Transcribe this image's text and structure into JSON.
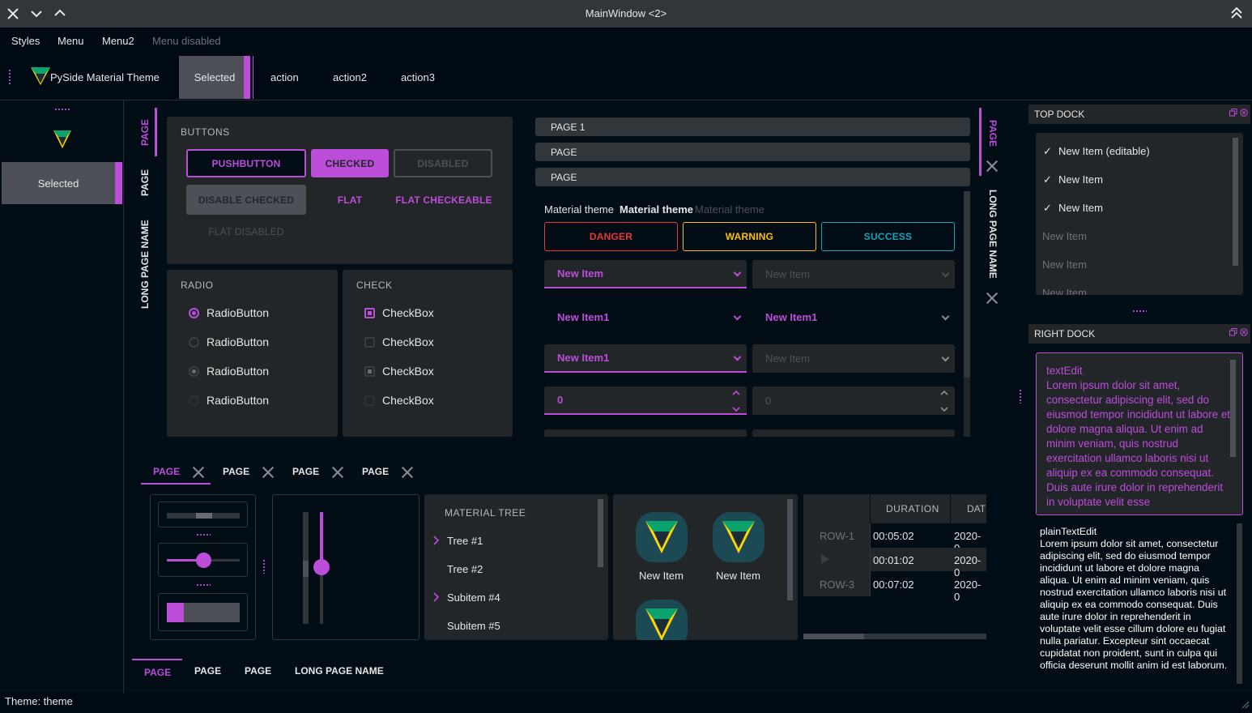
{
  "window": {
    "title": "MainWindow <2>"
  },
  "menubar": {
    "items": [
      "Styles",
      "Menu",
      "Menu2"
    ],
    "disabled_item": "Menu disabled"
  },
  "toolbar": {
    "app_name": "PySide Material Theme",
    "selected": "Selected",
    "actions": [
      "action",
      "action2",
      "action3"
    ]
  },
  "leftbar": {
    "selected": "Selected"
  },
  "vtabs_left": [
    "PAGE",
    "PAGE",
    "LONG PAGE NAME"
  ],
  "buttons": {
    "title": "BUTTONS",
    "pushbutton": "PUSHBUTTON",
    "checked": "CHECKED",
    "disabled": "DISABLED",
    "disable_checked": "DISABLE CHECKED",
    "flat": "FLAT",
    "flat_checkeable": "FLAT CHECKEABLE",
    "flat_disabled": "FLAT DISABLED"
  },
  "radio": {
    "title": "RADIO",
    "items": [
      "RadioButton",
      "RadioButton",
      "RadioButton",
      "RadioButton"
    ]
  },
  "check": {
    "title": "CHECK",
    "items": [
      "CheckBox",
      "CheckBox",
      "CheckBox",
      "CheckBox"
    ]
  },
  "toolbox": {
    "pages": [
      "PAGE 1",
      "PAGE",
      "PAGE"
    ]
  },
  "labels": {
    "normal": "Material theme",
    "bold": "Material theme",
    "disabled": "Material theme"
  },
  "status_buttons": {
    "danger": "DANGER",
    "warning": "WARNING",
    "success": "SUCCESS"
  },
  "combos": {
    "c1": "New Item",
    "c2": "New Item",
    "c3": "New Item1",
    "c4": "New Item1",
    "c5": "New Item1",
    "c6": "New Item",
    "spin1": "0",
    "spin2": "0"
  },
  "vtabs_right": [
    "PAGE",
    "LONG PAGE NAME"
  ],
  "htabs": [
    "PAGE",
    "PAGE",
    "PAGE",
    "PAGE"
  ],
  "tree": {
    "header": "MATERIAL TREE",
    "items": [
      "Tree #1",
      "Tree #2",
      "Subitem #4",
      "Subitem #5"
    ]
  },
  "iconlist": {
    "items": [
      "New Item",
      "New Item"
    ]
  },
  "table": {
    "headers": [
      "DURATION",
      "DAT"
    ],
    "rows": [
      {
        "label": "ROW-1",
        "duration": "00:05:02",
        "date": "2020-0"
      },
      {
        "label": "",
        "duration": "00:01:02",
        "date": "2020-0"
      },
      {
        "label": "ROW-3",
        "duration": "00:07:02",
        "date": "2020-0"
      }
    ]
  },
  "bottom_tabs": [
    "PAGE",
    "PAGE",
    "PAGE",
    "LONG PAGE NAME"
  ],
  "top_dock": {
    "title": "TOP DOCK",
    "items": [
      {
        "label": "New Item (editable)",
        "checked": true
      },
      {
        "label": "New Item",
        "checked": true
      },
      {
        "label": "New Item",
        "checked": true
      },
      {
        "label": "New Item",
        "checked": false
      },
      {
        "label": "New Item",
        "checked": false
      },
      {
        "label": "New Item",
        "checked": false
      }
    ],
    "checkmark": "✓"
  },
  "right_dock": {
    "title": "RIGHT DOCK",
    "textedit": "textEdit\nLorem ipsum dolor sit amet, consectetur adipiscing elit, sed do eiusmod tempor incididunt ut labore et dolore magna aliqua. Ut enim ad minim veniam, quis nostrud exercitation ullamco laboris nisi ut aliquip ex ea commodo consequat. Duis aute irure dolor in reprehenderit in voluptate velit esse",
    "plaintext": "plainTextEdit\nLorem ipsum dolor sit amet, consectetur adipiscing elit, sed do eiusmod tempor incididunt ut labore et dolore magna aliqua. Ut enim ad minim veniam, quis nostrud exercitation ullamco laboris nisi ut aliquip ex ea commodo consequat. Duis aute irure dolor in reprehenderit in voluptate velit esse cillum dolore eu fugiat nulla pariatur. Excepteur sint occaecat cupidatat non proident, sunt in culpa qui officia deserunt mollit anim id est laborum."
  },
  "statusbar": {
    "text": "Theme: theme"
  },
  "colors": {
    "accent": "#bb4dd9",
    "danger": "#e53935",
    "warning": "#ffc107",
    "success": "#17a2b8",
    "bg": "#020d16",
    "panel": "#232629"
  }
}
